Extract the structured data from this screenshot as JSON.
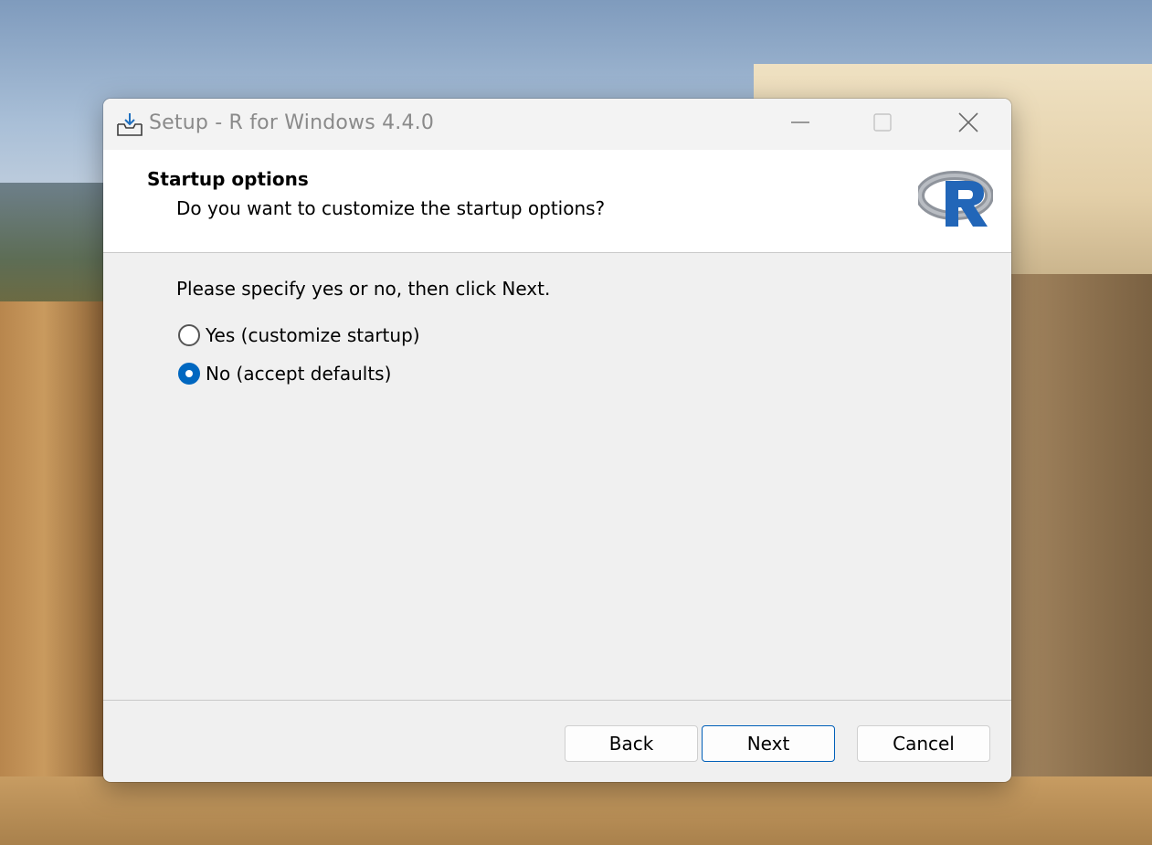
{
  "window": {
    "title": "Setup - R for Windows 4.4.0",
    "controls": [
      "minimize-icon",
      "maximize-icon",
      "close-icon"
    ]
  },
  "header": {
    "title": "Startup options",
    "subtitle": "Do you want to customize the startup options?",
    "logo": "r-logo"
  },
  "body": {
    "instructions": "Please specify yes or no, then click Next.",
    "options": [
      {
        "label": "Yes (customize startup)",
        "selected": false
      },
      {
        "label": "No (accept defaults)",
        "selected": true
      }
    ]
  },
  "footer": {
    "back_label": "Back",
    "next_label": "Next",
    "cancel_label": "Cancel"
  },
  "colors": {
    "accent": "#0067c0",
    "logo_blue": "#2266b8",
    "logo_gray": "#8f949c"
  }
}
